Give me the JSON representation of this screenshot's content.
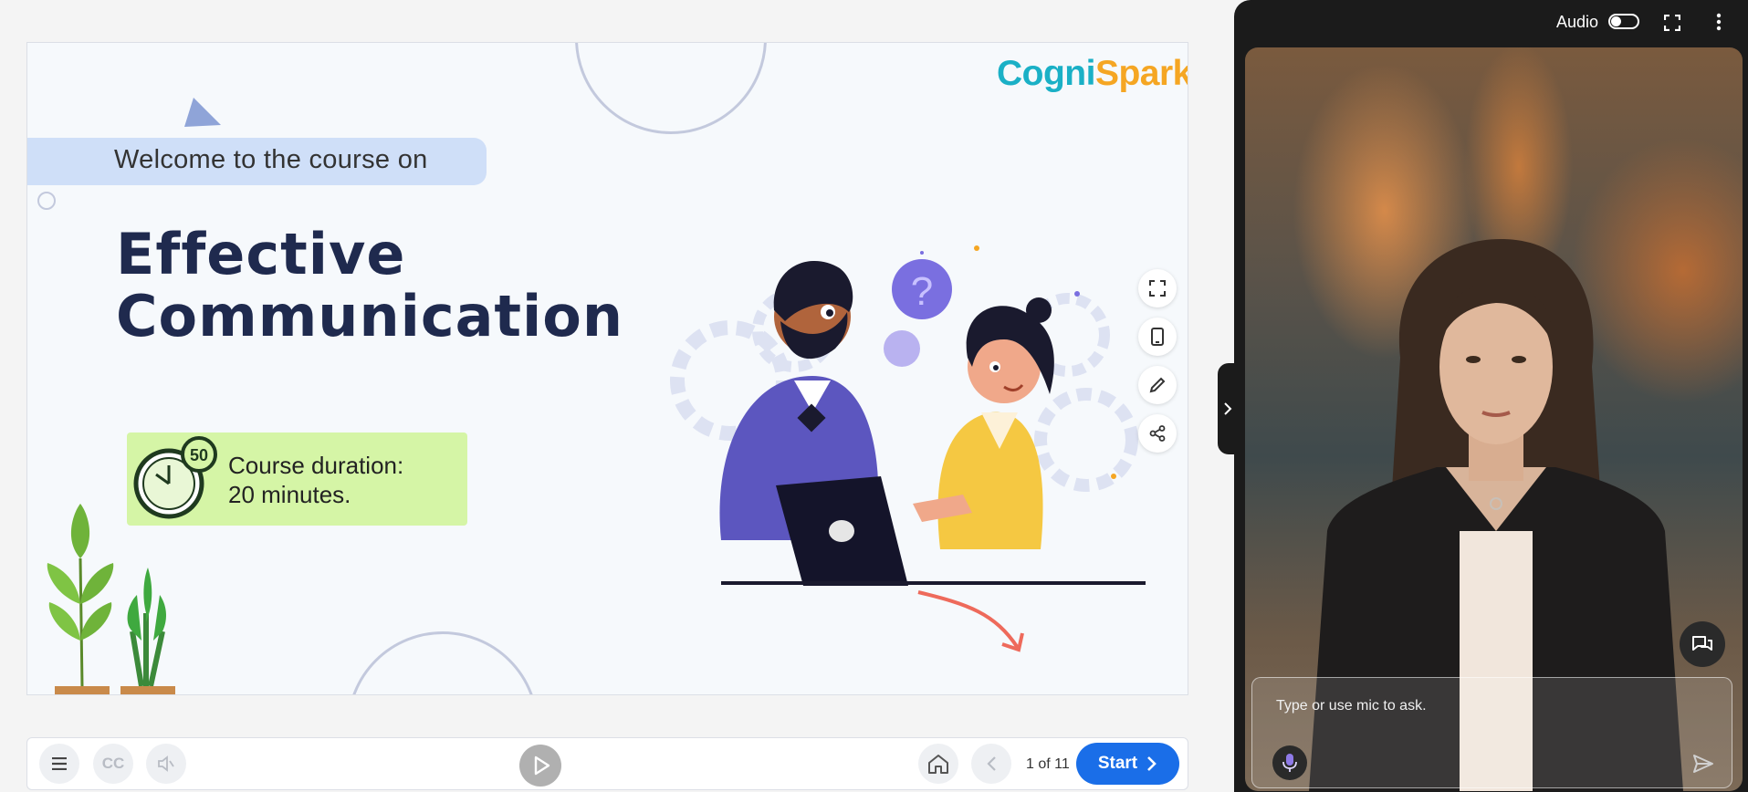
{
  "slide": {
    "welcome": "Welcome to the course on",
    "title_line1": "Effective",
    "title_line2": "Communication",
    "duration_line1": "Course duration:",
    "duration_line2": "20 minutes.",
    "clock_badge": "50",
    "logo_part1": "Cogni",
    "logo_part2": "Spark"
  },
  "toolbar": {
    "cc_label": "CC",
    "page_indicator": "1 of 11",
    "start_label": "Start"
  },
  "panel": {
    "audio_label": "Audio",
    "audio_on": false,
    "ask_placeholder": "Type or use mic to ask."
  },
  "colors": {
    "accent": "#1a6ee8",
    "title": "#1f2a4e",
    "duration_card": "#d5f5a6",
    "welcome_band": "#cfdff8",
    "panel_bg": "#1b1b1b"
  }
}
